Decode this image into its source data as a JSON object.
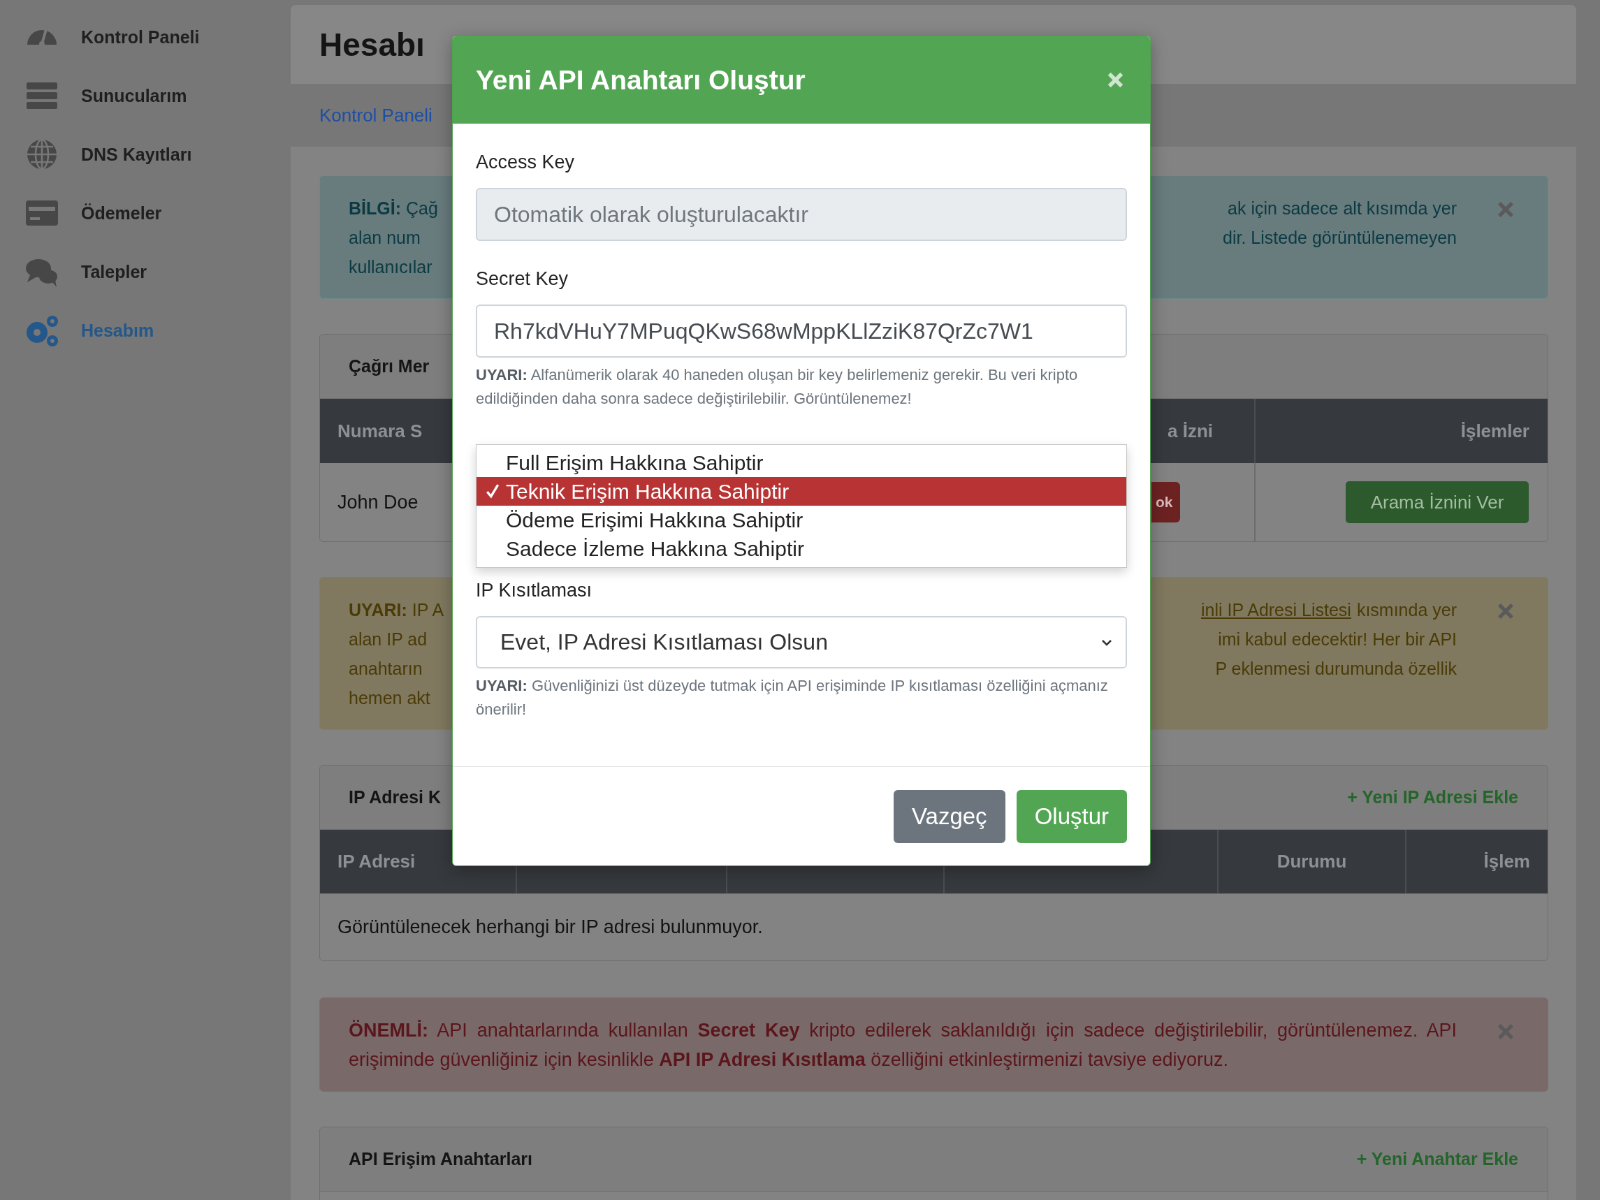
{
  "sidebar": {
    "items": [
      {
        "label": "Kontrol Paneli",
        "selected": false
      },
      {
        "label": "Sunucularım",
        "selected": false
      },
      {
        "label": "DNS Kayıtları",
        "selected": false
      },
      {
        "label": "Ödemeler",
        "selected": false
      },
      {
        "label": "Talepler",
        "selected": false
      },
      {
        "label": "Hesabım",
        "selected": true
      }
    ]
  },
  "header": {
    "title": "Hesabı",
    "breadcrumb": "Kontrol Paneli"
  },
  "info_alert": {
    "left_lines": [
      "**BİLGİ:** Çağ",
      "alan num",
      "kullanıcılar"
    ],
    "right_lines": [
      "ak için sadece alt kısımda yer",
      "dir. Listede görüntülenemeyen"
    ]
  },
  "call_center": {
    "title": "Çağrı Mer",
    "columns": [
      {
        "label": "Numara S"
      },
      {
        "label": "a İzni"
      },
      {
        "label": "İşlemler"
      }
    ],
    "rows": [
      {
        "name": "John Doe",
        "permission": "ok",
        "action": "Arama İznini Ver"
      }
    ]
  },
  "warning_alert": {
    "left_lines": [
      "**UYARI:** IP A",
      "alan IP ad",
      "anahtarın",
      "hemen akt"
    ],
    "link": "inli IP Adresi Listesi",
    "right_lines": [
      "kısmında yer",
      "imi kabul edecektir! Her bir API",
      "P eklenmesi durumunda özellik"
    ]
  },
  "ip_card": {
    "title": "IP Adresi K",
    "add_link": "+ Yeni IP Adresi Ekle",
    "columns": [
      {
        "label": "IP Adresi"
      },
      {
        "label": "Durumu"
      },
      {
        "label": "İşlem"
      }
    ],
    "empty_message": "Görüntülenecek herhangi bir IP adresi bulunmuyor."
  },
  "important_alert": {
    "text": "**ÖNEMLİ:** API anahtarlarında kullanılan **Secret Key** kripto edilerek saklanıldığı için sadece değiştirilebilir, görüntülenemez. API erişiminde güvenliğiniz için kesinlikle **API IP Adresi Kısıtlama** özelliğini etkinleştirmenizi tavsiye ediyoruz."
  },
  "api_card": {
    "title": "API Erişim Anahtarları",
    "add_link": "+ Yeni Anahtar Ekle"
  },
  "modal": {
    "title": "Yeni API Anahtarı Oluştur",
    "fields": [
      {
        "kind": "input",
        "label": "Access Key",
        "placeholder": "Otomatik olarak oluşturulacaktır",
        "disabled": true
      },
      {
        "kind": "input",
        "label": "Secret Key",
        "value": "Rh7kdVHuY7MPuqQKwS68wMppKLlZziK87QrZc7W1",
        "disabled": false,
        "help": "**UYARI:** Alfanümerik olarak 40 haneden oluşan bir key belirlemeniz gerekir. Bu veri kripto edildiğinden daha sonra sadece değiştirilebilir. Görüntülenemez!"
      },
      {
        "kind": "dropdown",
        "options": [
          {
            "label": "Full Erişim Hakkına Sahiptir",
            "selected": false
          },
          {
            "label": "Teknik Erişim Hakkına Sahiptir",
            "selected": true
          },
          {
            "label": "Ödeme Erişimi Hakkına Sahiptir",
            "selected": false
          },
          {
            "label": "Sadece İzleme Hakkına Sahiptir",
            "selected": false
          }
        ]
      },
      {
        "kind": "select",
        "label": "IP Kısıtlaması",
        "value": "Evet, IP Adresi Kısıtlaması Olsun",
        "help": "**UYARI:** Güvenliğinizi üst düzeyde tutmak için API erişiminde IP kısıtlaması özelliğini açmanız önerilir!"
      }
    ],
    "buttons": [
      {
        "label": "Vazgeç",
        "kind": "secondary"
      },
      {
        "label": "Oluştur",
        "kind": "primary"
      }
    ]
  }
}
